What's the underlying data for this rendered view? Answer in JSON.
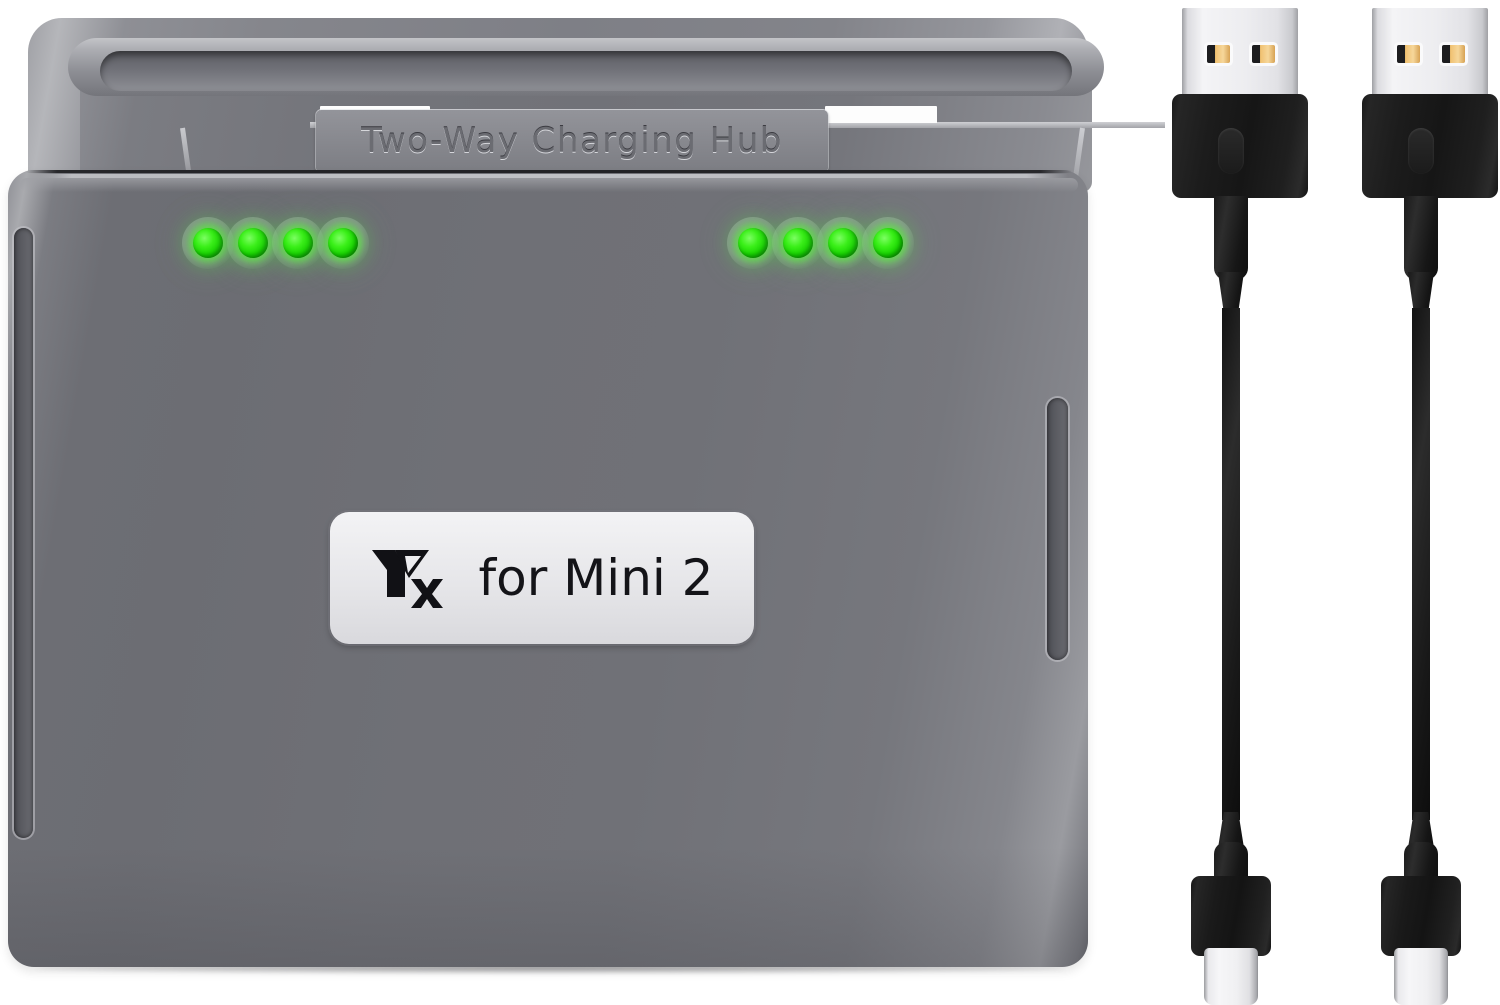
{
  "scene": {
    "background_color": "#ffffff",
    "subject": "Two-Way Charging Hub with two USB cables"
  },
  "hub": {
    "body_color": "#6f7076",
    "nameplate_text": "Two-Way  Charging  Hub",
    "label": {
      "brand_logo_name": "yx-brand-logo",
      "text": "for Mini 2",
      "plate_color": "#e9e9ec",
      "text_color": "#141418"
    },
    "leds": {
      "color": "#22e000",
      "left_group": [
        "led-1",
        "led-2",
        "led-3",
        "led-4"
      ],
      "right_group": [
        "led-5",
        "led-6",
        "led-7",
        "led-8"
      ]
    },
    "battery_slots": [
      "battery-slot-left",
      "battery-slot-right"
    ],
    "ports": {
      "left_slot_name": "left-side-port-slot",
      "right_slot_name": "right-side-port-slot"
    }
  },
  "cables": [
    {
      "name": "usb-cable-1",
      "connector_a": "USB-A",
      "connector_b": "USB-C",
      "cable_color": "#161616",
      "usb_a_shell_color": "#eeeef0",
      "usb_a_contact_color": "#f0c070",
      "usb_c_tip_color": "#f1f1f3"
    },
    {
      "name": "usb-cable-2",
      "connector_a": "USB-A",
      "connector_b": "USB-C",
      "cable_color": "#161616",
      "usb_a_shell_color": "#eeeef0",
      "usb_a_contact_color": "#f0c070",
      "usb_c_tip_color": "#f1f1f3"
    }
  ]
}
